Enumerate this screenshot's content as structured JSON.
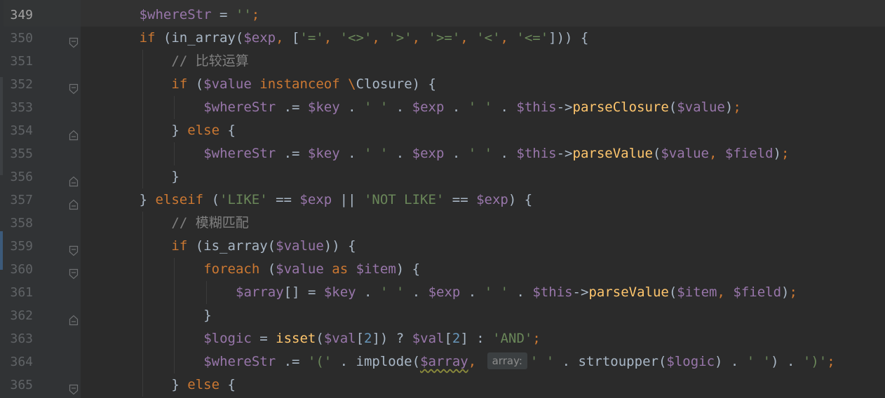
{
  "editor": {
    "lines": [
      {
        "n": "349",
        "current": true,
        "fold": "none",
        "indent": 2,
        "tokens": [
          [
            "var",
            "$whereStr"
          ],
          [
            "pl",
            " = "
          ],
          [
            "str",
            "''"
          ],
          [
            "kw",
            ";"
          ]
        ]
      },
      {
        "n": "350",
        "current": false,
        "fold": "start",
        "indent": 2,
        "tokens": [
          [
            "kw",
            "if"
          ],
          [
            "pl",
            " (in_array("
          ],
          [
            "var",
            "$exp"
          ],
          [
            "kw",
            ", "
          ],
          [
            "pl",
            "["
          ],
          [
            "str",
            "'='"
          ],
          [
            "kw",
            ", "
          ],
          [
            "str",
            "'<>'"
          ],
          [
            "kw",
            ", "
          ],
          [
            "str",
            "'>'"
          ],
          [
            "kw",
            ", "
          ],
          [
            "str",
            "'>='"
          ],
          [
            "kw",
            ", "
          ],
          [
            "str",
            "'<'"
          ],
          [
            "kw",
            ", "
          ],
          [
            "str",
            "'<='"
          ],
          [
            "pl",
            "])) {"
          ]
        ]
      },
      {
        "n": "351",
        "current": false,
        "fold": "none",
        "indent": 3,
        "tokens": [
          [
            "cm",
            "// 比较运算"
          ]
        ]
      },
      {
        "n": "352",
        "current": false,
        "fold": "start",
        "indent": 3,
        "tokens": [
          [
            "kw",
            "if"
          ],
          [
            "pl",
            " ("
          ],
          [
            "var",
            "$value"
          ],
          [
            "pl",
            " "
          ],
          [
            "kw",
            "instanceof"
          ],
          [
            "pl",
            " "
          ],
          [
            "kw",
            "\\"
          ],
          [
            "pl",
            "Closure) {"
          ]
        ]
      },
      {
        "n": "353",
        "current": false,
        "fold": "none",
        "indent": 4,
        "tokens": [
          [
            "var",
            "$whereStr"
          ],
          [
            "pl",
            " .= "
          ],
          [
            "var",
            "$key"
          ],
          [
            "pl",
            " . "
          ],
          [
            "str",
            "' '"
          ],
          [
            "pl",
            " . "
          ],
          [
            "var",
            "$exp"
          ],
          [
            "pl",
            " . "
          ],
          [
            "str",
            "' '"
          ],
          [
            "pl",
            " . "
          ],
          [
            "var",
            "$this"
          ],
          [
            "pl",
            "->"
          ],
          [
            "fn",
            "parseClosure"
          ],
          [
            "pl",
            "("
          ],
          [
            "var",
            "$value"
          ],
          [
            "pl",
            ")"
          ],
          [
            "kw",
            ";"
          ]
        ]
      },
      {
        "n": "354",
        "current": false,
        "fold": "end",
        "indent": 3,
        "tokens": [
          [
            "pl",
            "} "
          ],
          [
            "kw",
            "else"
          ],
          [
            "pl",
            " {"
          ]
        ]
      },
      {
        "n": "355",
        "current": false,
        "fold": "none",
        "indent": 4,
        "tokens": [
          [
            "var",
            "$whereStr"
          ],
          [
            "pl",
            " .= "
          ],
          [
            "var",
            "$key"
          ],
          [
            "pl",
            " . "
          ],
          [
            "str",
            "' '"
          ],
          [
            "pl",
            " . "
          ],
          [
            "var",
            "$exp"
          ],
          [
            "pl",
            " . "
          ],
          [
            "str",
            "' '"
          ],
          [
            "pl",
            " . "
          ],
          [
            "var",
            "$this"
          ],
          [
            "pl",
            "->"
          ],
          [
            "fn",
            "parseValue"
          ],
          [
            "pl",
            "("
          ],
          [
            "var",
            "$value"
          ],
          [
            "kw",
            ", "
          ],
          [
            "var",
            "$field"
          ],
          [
            "pl",
            ")"
          ],
          [
            "kw",
            ";"
          ]
        ]
      },
      {
        "n": "356",
        "current": false,
        "fold": "end",
        "indent": 3,
        "tokens": [
          [
            "pl",
            "}"
          ]
        ]
      },
      {
        "n": "357",
        "current": false,
        "fold": "end",
        "indent": 2,
        "tokens": [
          [
            "pl",
            "} "
          ],
          [
            "kw",
            "elseif"
          ],
          [
            "pl",
            " ("
          ],
          [
            "str",
            "'LIKE'"
          ],
          [
            "pl",
            " == "
          ],
          [
            "var",
            "$exp"
          ],
          [
            "pl",
            " || "
          ],
          [
            "str",
            "'NOT LIKE'"
          ],
          [
            "pl",
            " == "
          ],
          [
            "var",
            "$exp"
          ],
          [
            "pl",
            ") {"
          ]
        ]
      },
      {
        "n": "358",
        "current": false,
        "fold": "none",
        "indent": 3,
        "tokens": [
          [
            "cm",
            "// 模糊匹配"
          ]
        ]
      },
      {
        "n": "359",
        "current": false,
        "fold": "start",
        "indent": 3,
        "tokens": [
          [
            "kw",
            "if"
          ],
          [
            "pl",
            " (is_array("
          ],
          [
            "var",
            "$value"
          ],
          [
            "pl",
            ")) {"
          ]
        ]
      },
      {
        "n": "360",
        "current": false,
        "fold": "start",
        "indent": 4,
        "tokens": [
          [
            "kw",
            "foreach"
          ],
          [
            "pl",
            " ("
          ],
          [
            "var",
            "$value"
          ],
          [
            "pl",
            " "
          ],
          [
            "kw",
            "as"
          ],
          [
            "pl",
            " "
          ],
          [
            "var",
            "$item"
          ],
          [
            "pl",
            ") {"
          ]
        ]
      },
      {
        "n": "361",
        "current": false,
        "fold": "none",
        "indent": 5,
        "tokens": [
          [
            "var",
            "$array"
          ],
          [
            "pl",
            "[] = "
          ],
          [
            "var",
            "$key"
          ],
          [
            "pl",
            " . "
          ],
          [
            "str",
            "' '"
          ],
          [
            "pl",
            " . "
          ],
          [
            "var",
            "$exp"
          ],
          [
            "pl",
            " . "
          ],
          [
            "str",
            "' '"
          ],
          [
            "pl",
            " . "
          ],
          [
            "var",
            "$this"
          ],
          [
            "pl",
            "->"
          ],
          [
            "fn",
            "parseValue"
          ],
          [
            "pl",
            "("
          ],
          [
            "var",
            "$item"
          ],
          [
            "kw",
            ", "
          ],
          [
            "var",
            "$field"
          ],
          [
            "pl",
            ")"
          ],
          [
            "kw",
            ";"
          ]
        ]
      },
      {
        "n": "362",
        "current": false,
        "fold": "end",
        "indent": 4,
        "tokens": [
          [
            "pl",
            "}"
          ]
        ]
      },
      {
        "n": "363",
        "current": false,
        "fold": "none",
        "indent": 4,
        "tokens": [
          [
            "var",
            "$logic"
          ],
          [
            "pl",
            " = "
          ],
          [
            "fn",
            "isset"
          ],
          [
            "pl",
            "("
          ],
          [
            "var",
            "$val"
          ],
          [
            "pl",
            "["
          ],
          [
            "num",
            "2"
          ],
          [
            "pl",
            "]) ? "
          ],
          [
            "var",
            "$val"
          ],
          [
            "pl",
            "["
          ],
          [
            "num",
            "2"
          ],
          [
            "pl",
            "] : "
          ],
          [
            "str",
            "'AND'"
          ],
          [
            "kw",
            ";"
          ]
        ]
      },
      {
        "n": "364",
        "current": false,
        "fold": "none",
        "indent": 4,
        "tokens": [
          [
            "var",
            "$whereStr"
          ],
          [
            "pl",
            " .= "
          ],
          [
            "str",
            "'('"
          ],
          [
            "pl",
            " . implode("
          ],
          [
            "var squiggle",
            "$array"
          ],
          [
            "kw",
            ", "
          ],
          [
            "hint",
            "array:"
          ],
          [
            "str",
            "' '"
          ],
          [
            "pl",
            " . strtoupper("
          ],
          [
            "var",
            "$logic"
          ],
          [
            "pl",
            ") . "
          ],
          [
            "str",
            "' '"
          ],
          [
            "pl",
            ") . "
          ],
          [
            "str",
            "')'"
          ],
          [
            "kw",
            ";"
          ]
        ]
      },
      {
        "n": "365",
        "current": false,
        "fold": "start",
        "indent": 3,
        "tokens": [
          [
            "pl",
            "} "
          ],
          [
            "kw",
            "else"
          ],
          [
            "pl",
            " {"
          ]
        ]
      }
    ]
  }
}
